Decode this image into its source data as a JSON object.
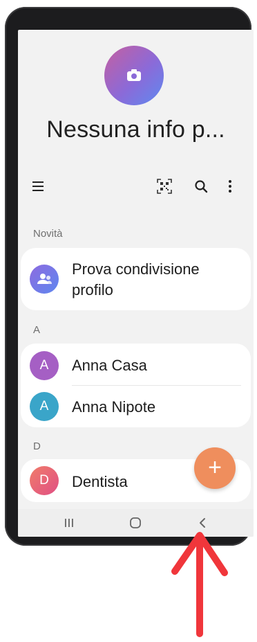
{
  "profile": {
    "name": "Nessuna info p..."
  },
  "toolbar": {
    "icons": [
      "menu-icon",
      "qr-code-icon",
      "search-icon",
      "more-options-icon"
    ]
  },
  "sections": {
    "novita": {
      "label": "Novità",
      "items": [
        {
          "name": "Prova condivisione profilo",
          "icon": "shared-profile-icon"
        }
      ]
    },
    "a": {
      "label": "A",
      "items": [
        {
          "initial": "A",
          "name": "Anna Casa",
          "color": "#a55fc4"
        },
        {
          "initial": "A",
          "name": "Anna Nipote",
          "color": "#3aa5c9"
        }
      ]
    },
    "d": {
      "label": "D",
      "items": [
        {
          "initial": "D",
          "name": "Dentista",
          "color": "#e8667a"
        }
      ]
    }
  },
  "fab": {
    "symbol": "+",
    "color": "#ef8e5d"
  },
  "navbar": {
    "icons": [
      "recent-apps-icon",
      "home-icon",
      "back-icon"
    ]
  },
  "annotation": {
    "color": "#f0363b",
    "icon": "up-arrow-icon"
  }
}
